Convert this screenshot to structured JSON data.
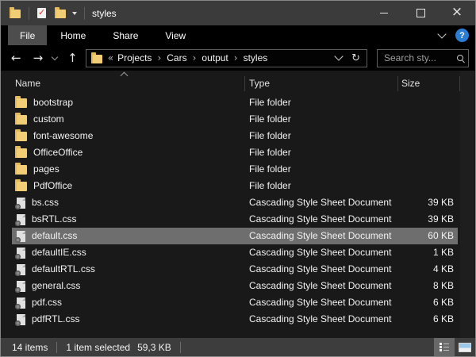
{
  "titlebar": {
    "title": "styles"
  },
  "ribbon": {
    "tabs": [
      "File",
      "Home",
      "Share",
      "View"
    ],
    "active_tab": "File"
  },
  "nav": {
    "breadcrumb_prefix": "«",
    "crumbs": [
      "Projects",
      "Cars",
      "output",
      "styles"
    ],
    "search_placeholder": "Search sty..."
  },
  "columns": {
    "name": "Name",
    "type": "Type",
    "size": "Size"
  },
  "rows": [
    {
      "name": "bootstrap",
      "type": "File folder",
      "size": "",
      "icon": "folder-icon",
      "selected": false
    },
    {
      "name": "custom",
      "type": "File folder",
      "size": "",
      "icon": "folder-icon",
      "selected": false
    },
    {
      "name": "font-awesome",
      "type": "File folder",
      "size": "",
      "icon": "folder-icon",
      "selected": false
    },
    {
      "name": "OfficeOffice",
      "type": "File folder",
      "size": "",
      "icon": "folder-icon",
      "selected": false
    },
    {
      "name": "pages",
      "type": "File folder",
      "size": "",
      "icon": "folder-icon",
      "selected": false
    },
    {
      "name": "PdfOffice",
      "type": "File folder",
      "size": "",
      "icon": "folder-icon",
      "selected": false
    },
    {
      "name": "bs.css",
      "type": "Cascading Style Sheet Document",
      "size": "39 KB",
      "icon": "css-file-icon",
      "selected": false
    },
    {
      "name": "bsRTL.css",
      "type": "Cascading Style Sheet Document",
      "size": "39 KB",
      "icon": "css-file-icon",
      "selected": false
    },
    {
      "name": "default.css",
      "type": "Cascading Style Sheet Document",
      "size": "60 KB",
      "icon": "css-file-icon",
      "selected": true
    },
    {
      "name": "defaultIE.css",
      "type": "Cascading Style Sheet Document",
      "size": "1 KB",
      "icon": "css-file-icon",
      "selected": false
    },
    {
      "name": "defaultRTL.css",
      "type": "Cascading Style Sheet Document",
      "size": "4 KB",
      "icon": "css-file-icon",
      "selected": false
    },
    {
      "name": "general.css",
      "type": "Cascading Style Sheet Document",
      "size": "8 KB",
      "icon": "css-file-icon",
      "selected": false
    },
    {
      "name": "pdf.css",
      "type": "Cascading Style Sheet Document",
      "size": "6 KB",
      "icon": "css-file-icon",
      "selected": false
    },
    {
      "name": "pdfRTL.css",
      "type": "Cascading Style Sheet Document",
      "size": "6 KB",
      "icon": "css-file-icon",
      "selected": false
    }
  ],
  "status": {
    "items_count": "14 items",
    "selection": "1 item selected",
    "selection_size": "59,3 KB",
    "help_label": "?"
  }
}
